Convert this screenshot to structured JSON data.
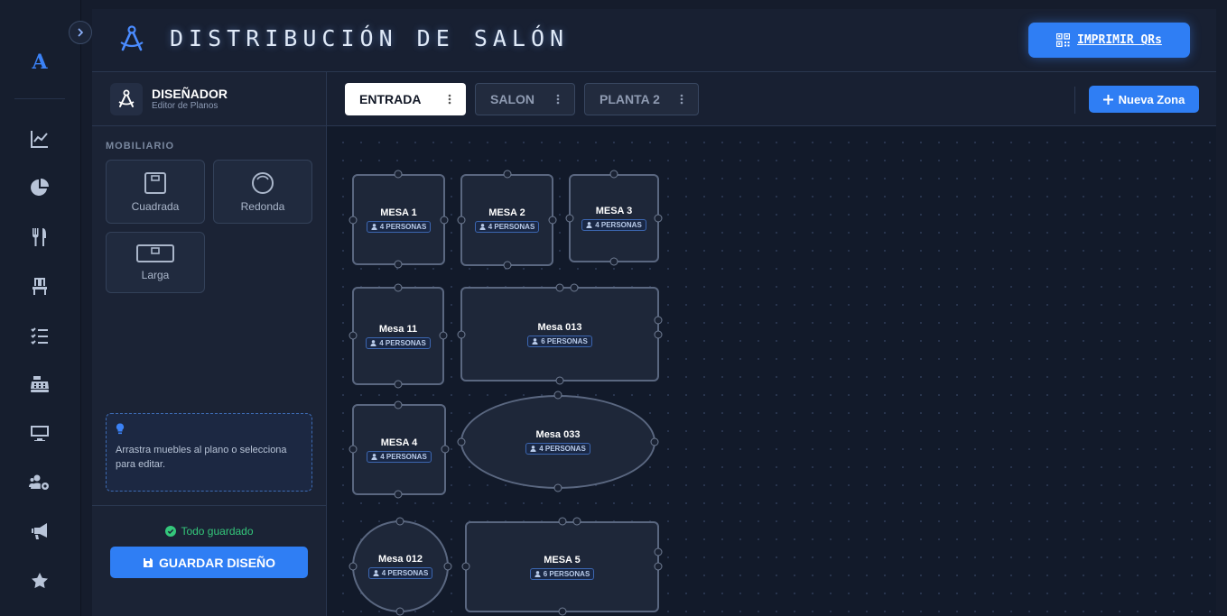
{
  "header": {
    "title": "DISTRIBUCIÓN DE SALÓN",
    "print_label": "IMPRIMIR QRs"
  },
  "rail": {
    "logo": "A",
    "icons": [
      "chart-line-icon",
      "pie-chart-icon",
      "utensils-icon",
      "chair-icon",
      "checklist-icon",
      "cash-register-icon",
      "monitor-icon",
      "users-cog-icon",
      "megaphone-icon",
      "star-icon"
    ]
  },
  "sidebar": {
    "title": "DISEÑADOR",
    "subtitle": "Editor de Planos",
    "section_label": "MOBILIARIO",
    "furniture": [
      {
        "label": "Cuadrada"
      },
      {
        "label": "Redonda"
      },
      {
        "label": "Larga"
      }
    ],
    "hint": "Arrastra muebles al plano o selecciona para editar.",
    "saved_status": "Todo guardado",
    "save_label": "GUARDAR DISEÑO"
  },
  "zones": {
    "tabs": [
      {
        "label": "ENTRADA",
        "active": true
      },
      {
        "label": "SALON",
        "active": false
      },
      {
        "label": "PLANTA 2",
        "active": false
      }
    ],
    "new_zone_label": "Nueva Zona"
  },
  "tables": [
    {
      "name": "MESA 1",
      "capacity": "4 PERSONAS",
      "shape": "rect"
    },
    {
      "name": "MESA 2",
      "capacity": "4 PERSONAS",
      "shape": "rect"
    },
    {
      "name": "MESA 3",
      "capacity": "4 PERSONAS",
      "shape": "rect"
    },
    {
      "name": "Mesa 11",
      "capacity": "4 PERSONAS",
      "shape": "rect"
    },
    {
      "name": "Mesa 013",
      "capacity": "6 PERSONAS",
      "shape": "rect"
    },
    {
      "name": "MESA 4",
      "capacity": "4 PERSONAS",
      "shape": "rect"
    },
    {
      "name": "Mesa 033",
      "capacity": "4 PERSONAS",
      "shape": "ellipse"
    },
    {
      "name": "Mesa 012",
      "capacity": "4 PERSONAS",
      "shape": "round"
    },
    {
      "name": "MESA 5",
      "capacity": "6 PERSONAS",
      "shape": "rect"
    }
  ],
  "colors": {
    "accent": "#2f7ef4",
    "success": "#34c77b",
    "background": "#151c2c"
  }
}
